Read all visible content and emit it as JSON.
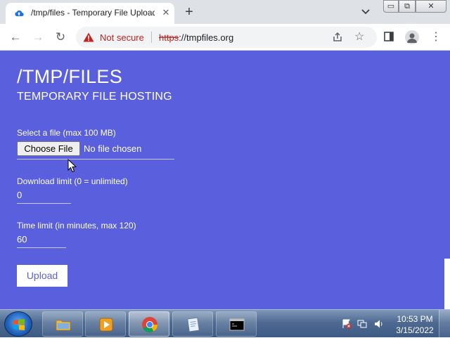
{
  "browser": {
    "tab_title": "/tmp/files - Temporary File Upload",
    "tab_close": "✕",
    "new_tab": "+",
    "window_min": "▭",
    "window_max": "⧉",
    "window_close": "✕"
  },
  "toolbar": {
    "back": "←",
    "forward": "→",
    "reload": "↻",
    "security_label": "Not secure",
    "url_scheme": "https",
    "url_rest": "://tmpfiles.org",
    "star": "☆",
    "menu": "⋮"
  },
  "page": {
    "title": "/TMP/FILES",
    "subtitle": "TEMPORARY FILE HOSTING",
    "file_label": "Select a file (max 100 MB)",
    "choose_button": "Choose File",
    "no_file": "No file chosen",
    "download_label": "Download limit (0 = unlimited)",
    "download_value": "0",
    "time_label": "Time limit (in minutes, max 120)",
    "time_value": "60",
    "upload_button": "Upload"
  },
  "taskbar": {
    "items": [
      "file-explorer",
      "media-player",
      "chrome",
      "notepad",
      "command-prompt"
    ],
    "active_item": "chrome",
    "time": "10:53 PM",
    "date": "3/15/2022"
  },
  "colors": {
    "page_background": "#5a5fdd",
    "not_secure": "#c5221f",
    "chrome_frame": "#dee1e6"
  }
}
